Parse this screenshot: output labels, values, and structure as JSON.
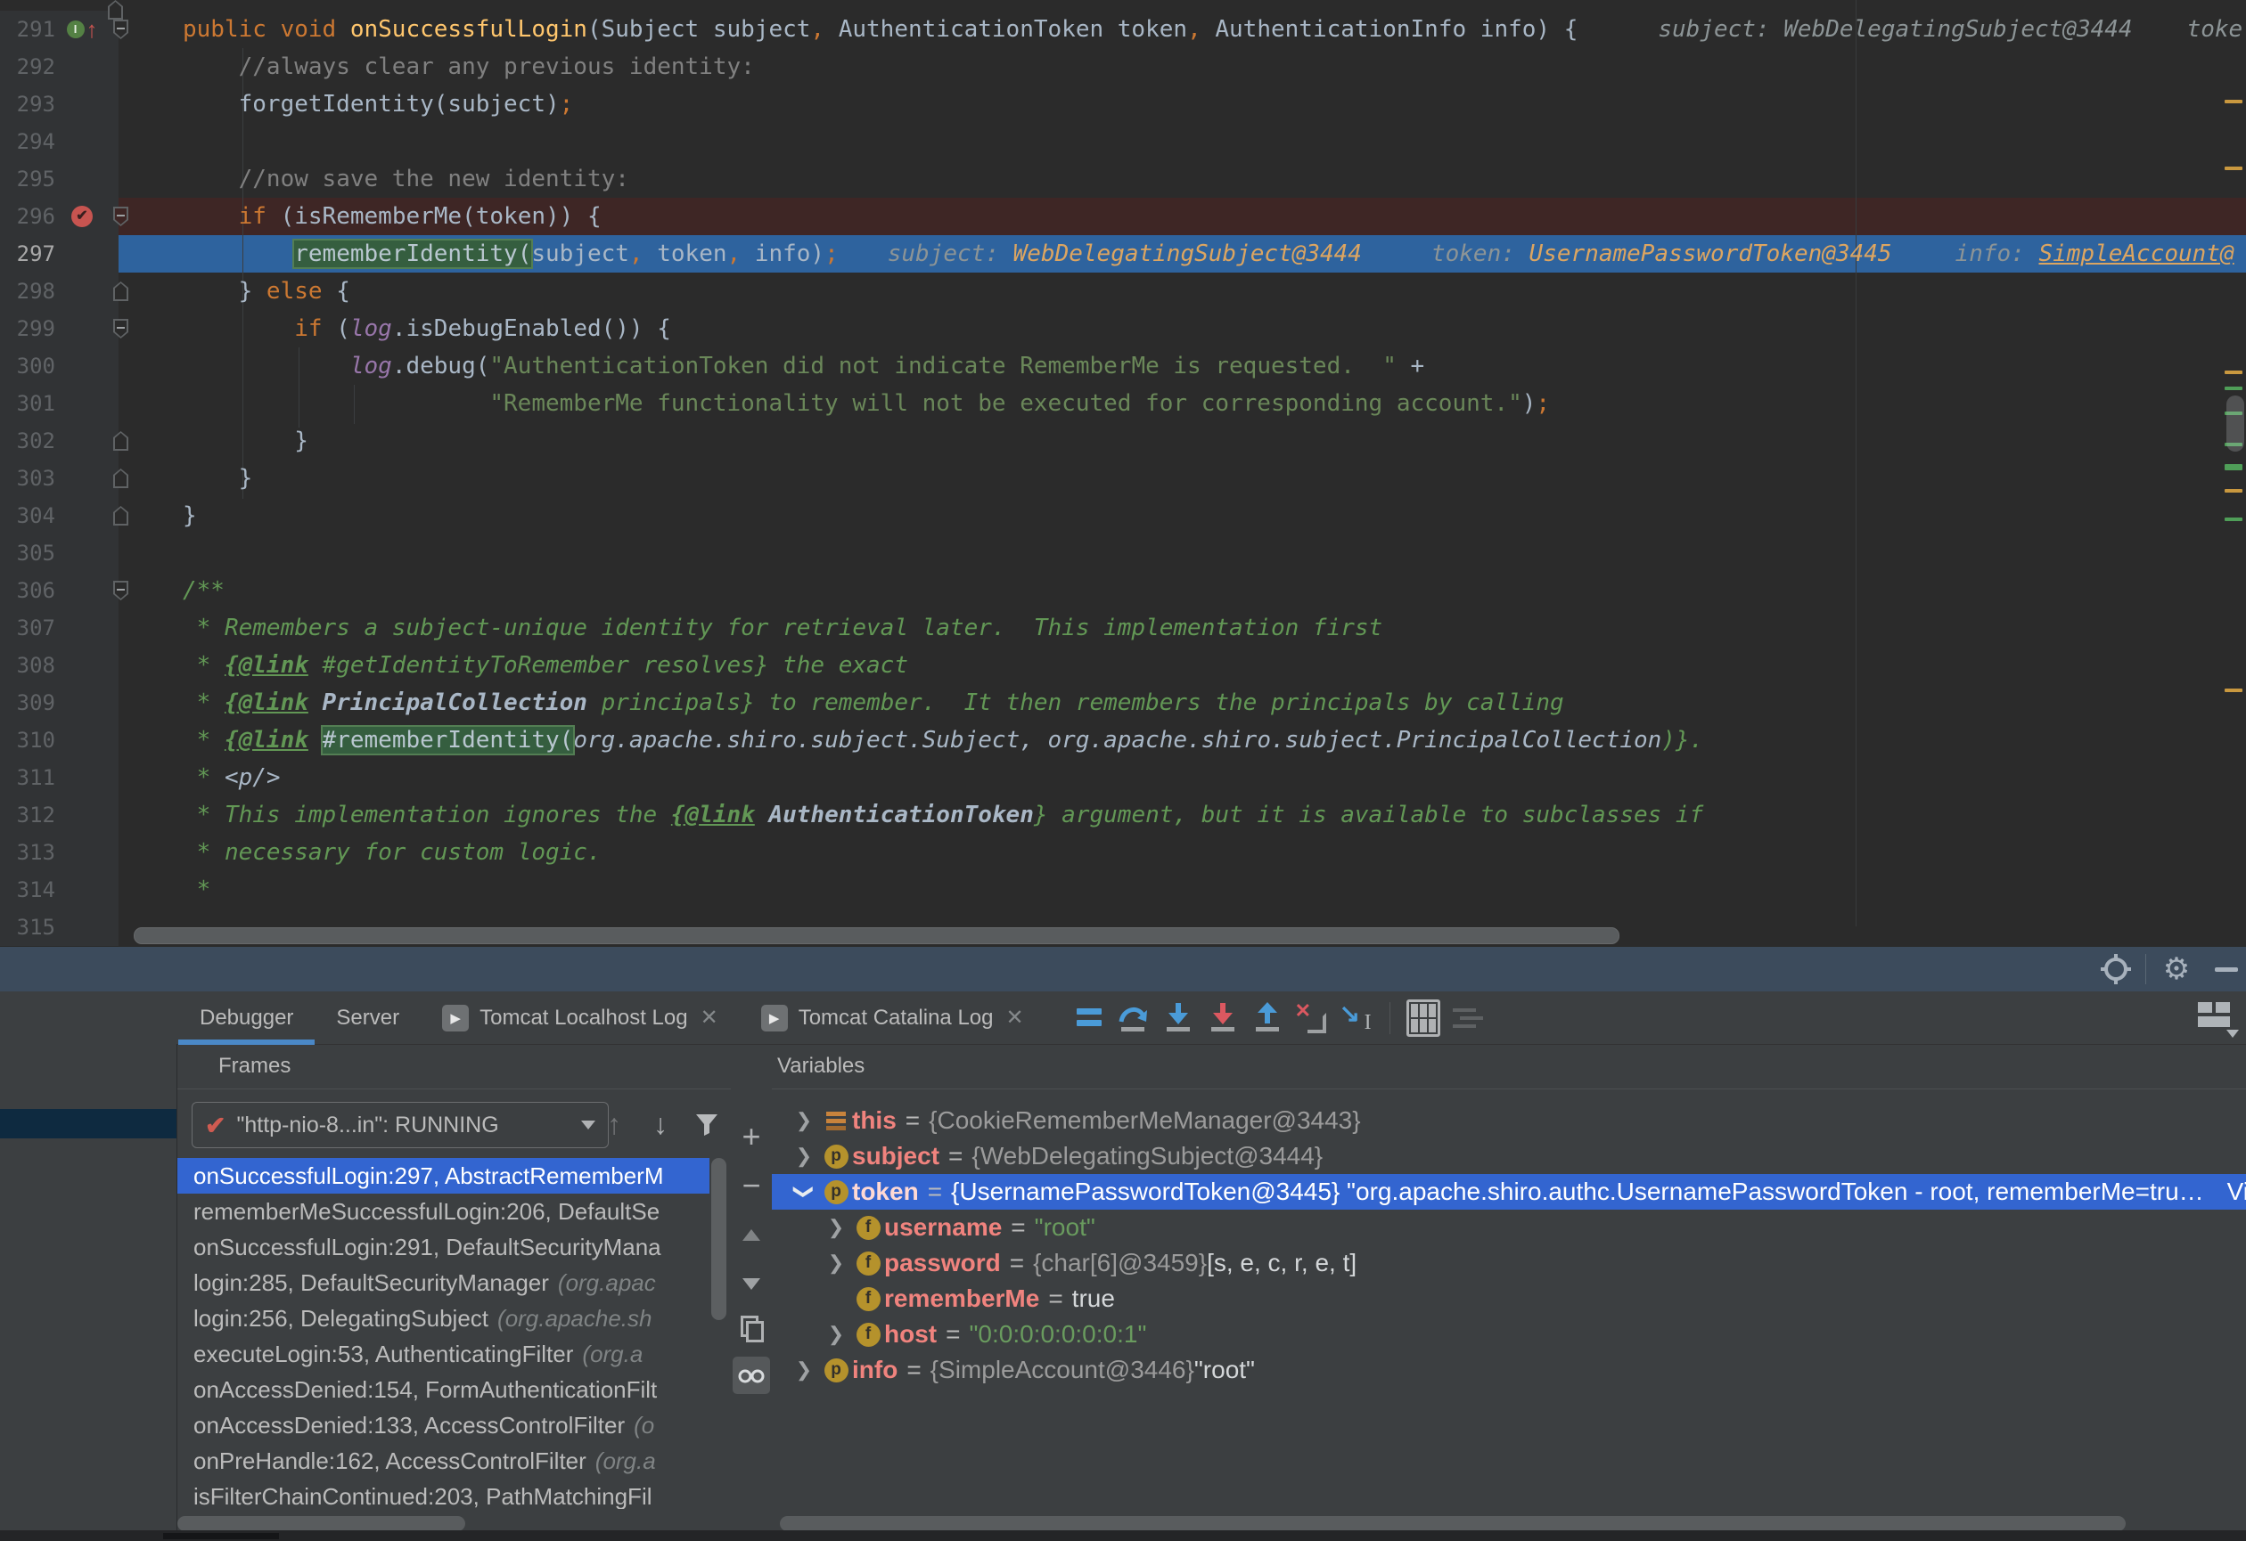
{
  "colors": {
    "editor_bg": "#2B2B2B",
    "exec_line": "#2E639E",
    "breakpoint_line": "#3E2625",
    "selection_blue": "#3365D0",
    "toolwindow_bar": "#3C4B5C",
    "panel_bg": "#3C3F41",
    "tab_underline": "#4A88C7",
    "keyword": "#CC7832",
    "string": "#6A8759",
    "javadoc": "#629755",
    "hint_value": "#DCA561",
    "var_name": "#F0837E"
  },
  "editor": {
    "lines": [
      {
        "n": 291,
        "g": "override",
        "f": "start",
        "s": [
          [
            "kw",
            "public void "
          ],
          [
            "mth",
            "onSuccessfulLogin"
          ],
          [
            "def",
            "(Subject subject"
          ],
          [
            "op",
            ","
          ],
          [
            "def",
            " AuthenticationToken token"
          ],
          [
            "op",
            ","
          ],
          [
            "def",
            " AuthenticationInfo info) {"
          ]
        ],
        "h": [
          {
            "ml": 90,
            "seg": [
              [
                "hl",
                "subject: WebDelegatingSubject@3444"
              ]
            ]
          },
          {
            "ml": 61,
            "seg": [
              [
                "hl",
                "toke"
              ]
            ]
          }
        ]
      },
      {
        "n": 292,
        "s": [
          [
            "def",
            "    "
          ],
          [
            "cmt",
            "//always clear any previous identity:"
          ]
        ]
      },
      {
        "n": 293,
        "s": [
          [
            "def",
            "    forgetIdentity(subject)"
          ],
          [
            "op",
            ";"
          ]
        ]
      },
      {
        "n": 294,
        "s": []
      },
      {
        "n": 295,
        "s": [
          [
            "def",
            "    "
          ],
          [
            "cmt",
            "//now save the new identity:"
          ]
        ]
      },
      {
        "n": 296,
        "bg": "bp",
        "g": "bp",
        "f": "start",
        "s": [
          [
            "def",
            "    "
          ],
          [
            "kw",
            "if"
          ],
          [
            "def",
            " (isRememberMe(token)) {"
          ]
        ]
      },
      {
        "n": 297,
        "bg": "exec",
        "s": [
          [
            "def",
            "        "
          ],
          [
            "selg",
            "rememberIdentity("
          ],
          [
            "def",
            "subject"
          ],
          [
            "op",
            ","
          ],
          [
            "def",
            " token"
          ],
          [
            "op",
            ","
          ],
          [
            "def",
            " info)"
          ],
          [
            "op",
            ";"
          ]
        ],
        "h": [
          {
            "ml": 55,
            "seg": [
              [
                "hl",
                "subject: "
              ],
              [
                "hv",
                "WebDelegatingSubject@3444"
              ]
            ]
          },
          {
            "ml": 78,
            "seg": [
              [
                "hl",
                "token: "
              ],
              [
                "hv",
                "UsernamePasswordToken@3445"
              ]
            ]
          },
          {
            "ml": 71,
            "seg": [
              [
                "hl",
                "info: "
              ],
              [
                "hvu",
                "SimpleAccount@"
              ]
            ]
          }
        ]
      },
      {
        "n": 298,
        "f": "end",
        "s": [
          [
            "def",
            "    } "
          ],
          [
            "kw",
            "else"
          ],
          [
            "def",
            " {"
          ]
        ]
      },
      {
        "n": 299,
        "f": "start",
        "s": [
          [
            "def",
            "        "
          ],
          [
            "kw",
            "if"
          ],
          [
            "def",
            " ("
          ],
          [
            "fld",
            "log"
          ],
          [
            "def",
            ".isDebugEnabled()) {"
          ]
        ]
      },
      {
        "n": 300,
        "s": [
          [
            "def",
            "            "
          ],
          [
            "fld",
            "log"
          ],
          [
            "def",
            ".debug("
          ],
          [
            "str",
            "\"AuthenticationToken did not indicate RememberMe is requested.  \""
          ],
          [
            "def",
            " +"
          ]
        ]
      },
      {
        "n": 301,
        "s": [
          [
            "def",
            "                      "
          ],
          [
            "str",
            "\"RememberMe functionality will not be executed for corresponding account.\""
          ],
          [
            "def",
            ")"
          ],
          [
            "op",
            ";"
          ]
        ]
      },
      {
        "n": 302,
        "f": "end",
        "s": [
          [
            "def",
            "        }"
          ]
        ]
      },
      {
        "n": 303,
        "f": "end",
        "s": [
          [
            "def",
            "    }"
          ]
        ]
      },
      {
        "n": 304,
        "f": "end",
        "s": [
          [
            "def",
            "}"
          ]
        ]
      },
      {
        "n": 305,
        "s": []
      },
      {
        "n": 306,
        "f": "start",
        "s": [
          [
            "doc",
            "/**"
          ]
        ]
      },
      {
        "n": 307,
        "s": [
          [
            "doc",
            " * Remembers a subject-unique identity for retrieval later.  This implementation first"
          ]
        ]
      },
      {
        "n": 308,
        "s": [
          [
            "doc",
            " * "
          ],
          [
            "dt",
            "{@link"
          ],
          [
            "doc",
            " #getIdentityToRemember resolves} the exact"
          ]
        ]
      },
      {
        "n": 309,
        "s": [
          [
            "doc",
            " * "
          ],
          [
            "dt",
            "{@link"
          ],
          [
            "doc",
            " "
          ],
          [
            "drb",
            "PrincipalCollection"
          ],
          [
            "doc",
            " principals} to remember.  It then remembers the principals by calling"
          ]
        ]
      },
      {
        "n": 310,
        "s": [
          [
            "doc",
            " * "
          ],
          [
            "dt",
            "{@link"
          ],
          [
            "doc",
            " "
          ],
          [
            "selg",
            "#rememberIdentity("
          ],
          [
            "dr",
            "org.apache.shiro.subject.Subject, org.apache.shiro.subject.PrincipalCollection"
          ],
          [
            "doc",
            ")}."
          ]
        ]
      },
      {
        "n": 311,
        "s": [
          [
            "doc",
            " * "
          ],
          [
            "dr",
            "<p/>"
          ]
        ]
      },
      {
        "n": 312,
        "s": [
          [
            "doc",
            " * This implementation ignores the "
          ],
          [
            "dt",
            "{@link"
          ],
          [
            "doc",
            " "
          ],
          [
            "drb",
            "AuthenticationToken"
          ],
          [
            "doc",
            "} argument, but it is available to subclasses if"
          ]
        ]
      },
      {
        "n": 313,
        "s": [
          [
            "doc",
            " * necessary for custom logic."
          ]
        ]
      },
      {
        "n": 314,
        "s": [
          [
            "doc",
            " *"
          ]
        ]
      },
      {
        "n": 315,
        "s": []
      }
    ],
    "stripe": {
      "orange": [
        112,
        187,
        416,
        549,
        773
      ],
      "green": [
        434,
        462,
        497,
        581
      ],
      "green_thick": [
        521
      ]
    }
  },
  "toolwindow_bar": {
    "icons": [
      "target",
      "gear",
      "minimize"
    ]
  },
  "debugger": {
    "tabs": [
      {
        "label": "Debugger",
        "selected": true
      },
      {
        "label": "Server",
        "selected": false
      },
      {
        "label": "Tomcat Localhost Log",
        "selected": false,
        "log_icon": true,
        "closable": true
      },
      {
        "label": "Tomcat Catalina Log",
        "selected": false,
        "log_icon": true,
        "closable": true
      }
    ],
    "toolbar": [
      "exec-point",
      "step-over",
      "step-into",
      "force-step-into",
      "step-out",
      "drop-frame",
      "run-to-cursor",
      "sep",
      "evaluate-expression",
      "trace-settings"
    ],
    "layout_button": "restore-layout"
  },
  "frames": {
    "title": "Frames",
    "thread": {
      "check": "✔",
      "label": "\"http-nio-8...in\": RUNNING"
    },
    "thread_toolbar": [
      "previous-frame",
      "next-frame",
      "filter"
    ],
    "rows": [
      {
        "main": "onSuccessfulLogin:297, AbstractRememberM",
        "pkg": "",
        "selected": true
      },
      {
        "main": "rememberMeSuccessfulLogin:206, DefaultSe",
        "pkg": ""
      },
      {
        "main": "onSuccessfulLogin:291, DefaultSecurityMana",
        "pkg": ""
      },
      {
        "main": "login:285, DefaultSecurityManager",
        "pkg": "(org.apac"
      },
      {
        "main": "login:256, DelegatingSubject",
        "pkg": "(org.apache.sh"
      },
      {
        "main": "executeLogin:53, AuthenticatingFilter",
        "pkg": "(org.a"
      },
      {
        "main": "onAccessDenied:154, FormAuthenticationFilt",
        "pkg": ""
      },
      {
        "main": "onAccessDenied:133, AccessControlFilter",
        "pkg": "(o"
      },
      {
        "main": "onPreHandle:162, AccessControlFilter",
        "pkg": "(org.a"
      },
      {
        "main": "isFilterChainContinued:203, PathMatchingFil",
        "pkg": ""
      }
    ]
  },
  "watch_toolbar": [
    "add-watch",
    "remove-watch",
    "move-up",
    "move-down",
    "duplicate",
    "show-watches"
  ],
  "variables": {
    "title": "Variables",
    "rows": [
      {
        "indent": 0,
        "chev": ">",
        "icon": "this",
        "name": "this",
        "value": [
          [
            "ref",
            "{CookieRememberMeManager@3443}"
          ]
        ]
      },
      {
        "indent": 0,
        "chev": ">",
        "icon": "p",
        "name": "subject",
        "value": [
          [
            "ref",
            "{WebDelegatingSubject@3444}"
          ]
        ]
      },
      {
        "indent": 0,
        "chev": "v",
        "icon": "p",
        "name": "token",
        "selected": true,
        "value": [
          [
            "wht",
            "{UsernamePasswordToken@3445} \"org.apache.shiro.authc.UsernamePasswordToken - root, rememberMe=tru…"
          ]
        ],
        "link": "View"
      },
      {
        "indent": 1,
        "chev": ">",
        "icon": "f",
        "name": "username",
        "value": [
          [
            "str",
            "\"root\""
          ]
        ]
      },
      {
        "indent": 1,
        "chev": ">",
        "icon": "f",
        "name": "password",
        "value": [
          [
            "ref",
            "{char[6]@3459}"
          ],
          [
            "wht",
            " [s, e, c, r, e, t]"
          ]
        ]
      },
      {
        "indent": 1,
        "chev": "",
        "icon": "f",
        "name": "rememberMe",
        "value": [
          [
            "wht",
            "true"
          ]
        ]
      },
      {
        "indent": 1,
        "chev": ">",
        "icon": "f",
        "name": "host",
        "value": [
          [
            "str",
            "\"0:0:0:0:0:0:0:1\""
          ]
        ]
      },
      {
        "indent": 0,
        "chev": ">",
        "icon": "p",
        "name": "info",
        "value": [
          [
            "ref",
            "{SimpleAccount@3446}"
          ],
          [
            "wht",
            " \"root\""
          ]
        ]
      }
    ]
  }
}
